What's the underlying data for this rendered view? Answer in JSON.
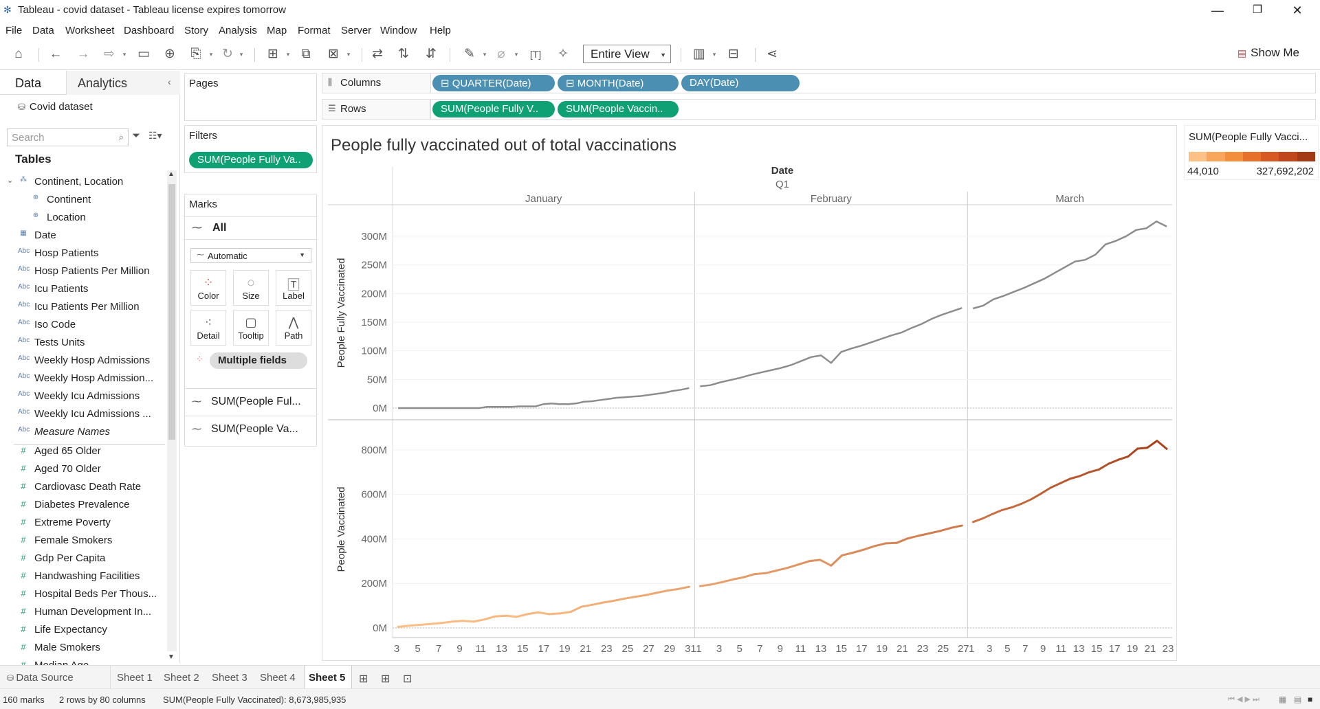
{
  "window": {
    "title": "Tableau - covid dataset - Tableau license expires tomorrow",
    "min": "—",
    "restore": "❐",
    "close": "✕"
  },
  "menu": [
    "File",
    "Data",
    "Worksheet",
    "Dashboard",
    "Story",
    "Analysis",
    "Map",
    "Format",
    "Server",
    "Window",
    "Help"
  ],
  "toolbar": {
    "fit": "Entire View",
    "show_me": "Show Me"
  },
  "datapane": {
    "tab_data": "Data",
    "tab_analytics": "Analytics",
    "datasource": "Covid dataset",
    "search_placeholder": "Search",
    "tables_header": "Tables",
    "fields": [
      {
        "icon": "hier",
        "label": "Continent, Location"
      },
      {
        "icon": "geo",
        "label": "Continent"
      },
      {
        "icon": "geo",
        "label": "Location"
      },
      {
        "icon": "date",
        "label": "Date"
      },
      {
        "icon": "abc",
        "label": "Hosp Patients"
      },
      {
        "icon": "abc",
        "label": "Hosp Patients Per Million"
      },
      {
        "icon": "abc",
        "label": "Icu Patients"
      },
      {
        "icon": "abc",
        "label": "Icu Patients Per Million"
      },
      {
        "icon": "abc",
        "label": "Iso Code"
      },
      {
        "icon": "abc",
        "label": "Tests Units"
      },
      {
        "icon": "abc",
        "label": "Weekly Hosp Admissions"
      },
      {
        "icon": "abc",
        "label": "Weekly Hosp Admission..."
      },
      {
        "icon": "abc",
        "label": "Weekly Icu Admissions"
      },
      {
        "icon": "abc",
        "label": "Weekly Icu Admissions ..."
      },
      {
        "icon": "abc",
        "label": "Measure Names"
      },
      {
        "icon": "num",
        "label": "Aged 65 Older"
      },
      {
        "icon": "num",
        "label": "Aged 70 Older"
      },
      {
        "icon": "num",
        "label": "Cardiovasc Death Rate"
      },
      {
        "icon": "num",
        "label": "Diabetes Prevalence"
      },
      {
        "icon": "num",
        "label": "Extreme Poverty"
      },
      {
        "icon": "num",
        "label": "Female Smokers"
      },
      {
        "icon": "num",
        "label": "Gdp Per Capita"
      },
      {
        "icon": "num",
        "label": "Handwashing Facilities"
      },
      {
        "icon": "num",
        "label": "Hospital Beds Per Thous..."
      },
      {
        "icon": "num",
        "label": "Human Development In..."
      },
      {
        "icon": "num",
        "label": "Life Expectancy"
      },
      {
        "icon": "num",
        "label": "Male Smokers"
      },
      {
        "icon": "num",
        "label": "Median Age"
      }
    ]
  },
  "shelves": {
    "pages": "Pages",
    "filters": "Filters",
    "filter_pill": "SUM(People Fully Va..",
    "columns_label": "Columns",
    "rows_label": "Rows",
    "columns": [
      "QUARTER(Date)",
      "MONTH(Date)",
      "DAY(Date)"
    ],
    "rows": [
      "SUM(People Fully V..",
      "SUM(People Vaccin.."
    ],
    "marks": "Marks",
    "marks_all": "All",
    "mark_type": "Automatic",
    "mark_buttons": [
      "Color",
      "Size",
      "Label",
      "Detail",
      "Tooltip",
      "Path"
    ],
    "multiple_fields": "Multiple fields",
    "mark_cards": [
      "SUM(People Ful...",
      "SUM(People Va..."
    ]
  },
  "legend": {
    "title": "SUM(People Fully Vacci...",
    "min": "44,010",
    "max": "327,692,202",
    "colors": [
      "#fdc086",
      "#f8a65b",
      "#f18f3d",
      "#e5712a",
      "#d65a22",
      "#c0461c",
      "#a33a16"
    ]
  },
  "chart_data": {
    "type": "line",
    "title": "People fully vaccinated out of total vaccinations",
    "header_date": "Date",
    "header_quarter": "Q1",
    "months": [
      "January",
      "February",
      "March"
    ],
    "x_ticks": {
      "January": [
        "3",
        "5",
        "7",
        "9",
        "11",
        "13",
        "15",
        "17",
        "19",
        "21",
        "23",
        "25",
        "27",
        "29",
        "31"
      ],
      "February": [
        "1",
        "3",
        "5",
        "7",
        "9",
        "11",
        "13",
        "15",
        "17",
        "19",
        "21",
        "23",
        "25",
        "27"
      ],
      "March": [
        "1",
        "3",
        "5",
        "7",
        "9",
        "11",
        "13",
        "15",
        "17",
        "19",
        "21",
        "23"
      ]
    },
    "panes": [
      {
        "ylabel": "People Fully Vaccinated",
        "yticks": [
          "0M",
          "50M",
          "100M",
          "150M",
          "200M",
          "250M",
          "300M"
        ],
        "ylim": [
          0,
          330
        ],
        "color": "#8c8c8c",
        "January": [
          0,
          0,
          0,
          0,
          0,
          0,
          0,
          0,
          0,
          0,
          0,
          2,
          2,
          2,
          2,
          3,
          3,
          3,
          7,
          8,
          7,
          7,
          8,
          11,
          12,
          14,
          16,
          18,
          19,
          20,
          21,
          23,
          25,
          27,
          30,
          32,
          35
        ],
        "February": [
          38,
          40,
          45,
          49,
          53,
          58,
          62,
          66,
          70,
          75,
          82,
          89,
          92,
          79,
          98,
          104,
          109,
          115,
          121,
          127,
          132,
          140,
          147,
          156,
          163,
          169,
          175
        ],
        "March": [
          174,
          179,
          190,
          196,
          203,
          210,
          218,
          226,
          236,
          246,
          256,
          259,
          268,
          286,
          292,
          300,
          311,
          314,
          326,
          317
        ]
      },
      {
        "ylabel": "People Vaccinated",
        "yticks": [
          "0M",
          "200M",
          "400M",
          "600M",
          "800M"
        ],
        "ylim": [
          0,
          880
        ],
        "color_start": "#fdc086",
        "color_end": "#a33a16",
        "January": [
          5,
          10,
          14,
          18,
          22,
          28,
          32,
          28,
          38,
          52,
          55,
          50,
          62,
          70,
          62,
          65,
          72,
          95,
          104,
          114,
          122,
          132,
          140,
          148,
          158,
          168,
          175,
          185
        ],
        "February": [
          188,
          195,
          206,
          218,
          228,
          242,
          246,
          258,
          270,
          285,
          300,
          306,
          280,
          326,
          338,
          352,
          368,
          380,
          382,
          402,
          414,
          425,
          436,
          450,
          460
        ],
        "March": [
          476,
          492,
          512,
          530,
          542,
          558,
          578,
          603,
          630,
          650,
          670,
          682,
          700,
          712,
          738,
          756,
          770,
          806,
          810,
          841,
          805
        ]
      }
    ]
  },
  "sheets": {
    "datasource": "Data Source",
    "tabs": [
      "Sheet 1",
      "Sheet 2",
      "Sheet 3",
      "Sheet 4",
      "Sheet 5"
    ],
    "active": "Sheet 5"
  },
  "status": {
    "marks": "160 marks",
    "dims": "2 rows by 80 columns",
    "sum": "SUM(People Fully Vaccinated): 8,673,985,935"
  }
}
